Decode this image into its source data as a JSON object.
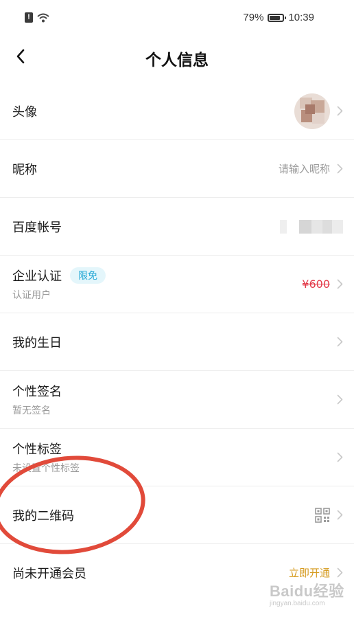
{
  "status_bar": {
    "alert_glyph": "!",
    "battery": "79%",
    "time": "10:39"
  },
  "header": {
    "title": "个人信息",
    "back_icon": "chevron-left-icon"
  },
  "rows": {
    "avatar": {
      "label": "头像",
      "icon": "avatar-image"
    },
    "nickname": {
      "label": "昵称",
      "value": "请输入昵称"
    },
    "baidu_account": {
      "label": "百度帐号",
      "value_hidden": true
    },
    "enterprise": {
      "label": "企业认证",
      "badge": "限免",
      "subtitle": "认证用户",
      "price": "¥600"
    },
    "birthday": {
      "label": "我的生日"
    },
    "signature": {
      "label": "个性签名",
      "subtitle": "暂无签名"
    },
    "tags": {
      "label": "个性标签",
      "subtitle": "未设置个性标签"
    },
    "qrcode": {
      "label": "我的二维码",
      "icon": "qr-code-icon"
    },
    "vip": {
      "label": "尚未开通会员",
      "action": "立即开通"
    }
  },
  "watermark": {
    "brand": "Baidu经验",
    "url": "jingyan.baidu.com"
  },
  "colors": {
    "badge_bg": "#e4f6fb",
    "badge_text": "#27a9d6",
    "price_strike": "#e33c4b",
    "vip_gold": "#d59a1d",
    "annotation_circle": "#e14a3a"
  }
}
